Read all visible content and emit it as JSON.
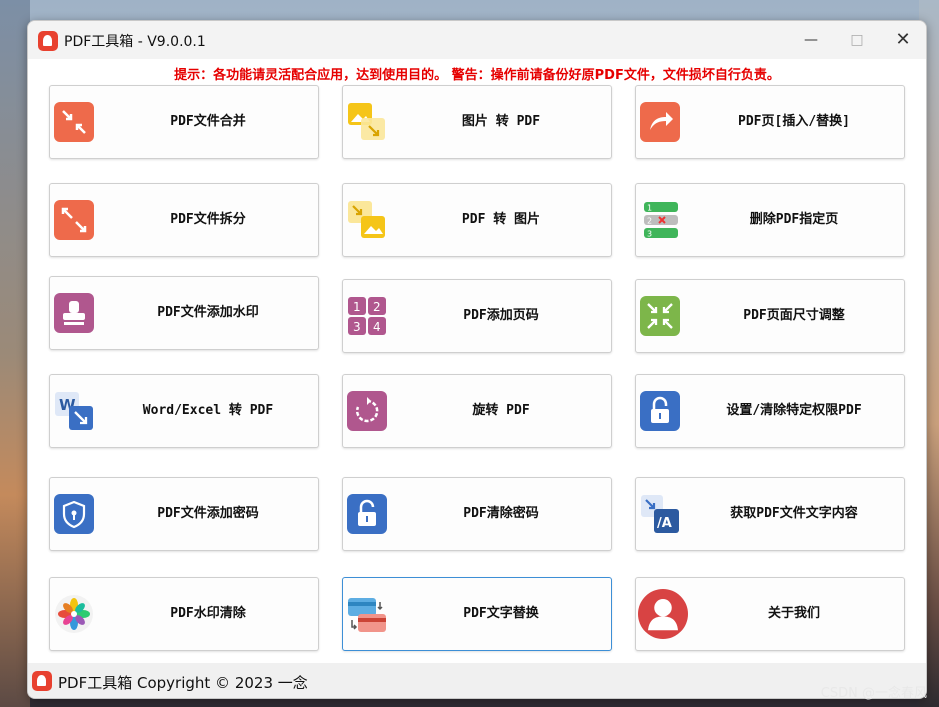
{
  "window": {
    "title": "PDF工具箱 - V9.0.0.1"
  },
  "notice": "提示：各功能请灵活配合应用，达到使用目的。 警告：操作前请备份好原PDF文件，文件损坏自行负责。",
  "tiles": [
    {
      "label": "PDF文件合并",
      "icon": "merge-icon"
    },
    {
      "label": "图片 转 PDF",
      "icon": "image-to-pdf-icon"
    },
    {
      "label": "PDF页[插入/替换]",
      "icon": "insert-page-icon"
    },
    {
      "label": "PDF文件拆分",
      "icon": "split-icon"
    },
    {
      "label": "PDF 转 图片",
      "icon": "pdf-to-image-icon"
    },
    {
      "label": "删除PDF指定页",
      "icon": "delete-page-icon"
    },
    {
      "label": "PDF文件添加水印",
      "icon": "stamp-icon"
    },
    {
      "label": "PDF添加页码",
      "icon": "page-number-icon"
    },
    {
      "label": "PDF页面尺寸调整",
      "icon": "resize-icon"
    },
    {
      "label": "Word/Excel 转 PDF",
      "icon": "word-icon"
    },
    {
      "label": "旋转 PDF",
      "icon": "rotate-icon"
    },
    {
      "label": "设置/清除特定权限PDF",
      "icon": "lock-icon"
    },
    {
      "label": "PDF文件添加密码",
      "icon": "shield-icon"
    },
    {
      "label": "PDF清除密码",
      "icon": "unlock-icon"
    },
    {
      "label": "获取PDF文件文字内容",
      "icon": "text-extract-icon"
    },
    {
      "label": "PDF水印清除",
      "icon": "flower-icon"
    },
    {
      "label": "PDF文字替换",
      "icon": "card-swap-icon"
    },
    {
      "label": "关于我们",
      "icon": "user-icon"
    }
  ],
  "status": {
    "text": "PDF工具箱 Copyright © 2023 一念"
  },
  "watermark": "CSDN @一念春风",
  "colors": {
    "notice": "#e60000",
    "selected_border": "#3d8fd6",
    "brand": "#e8412f"
  }
}
